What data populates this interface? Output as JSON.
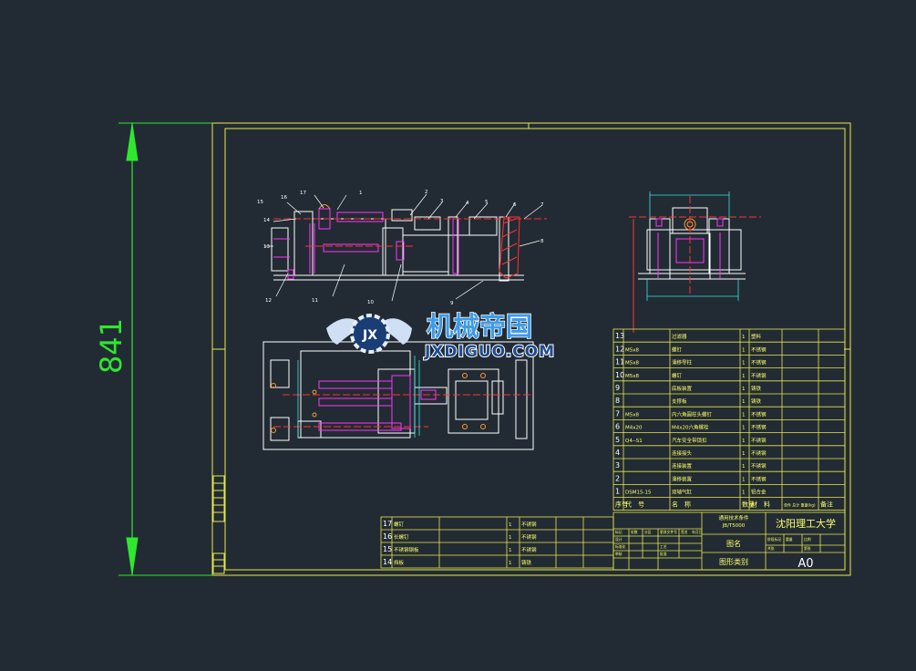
{
  "colors": {
    "background": "#222b33",
    "frame": "#e8e84a",
    "dimension": "#2ee82e",
    "outline": "#ffffff",
    "part": "#ff33ff",
    "center": "#ff3333",
    "hidden": "#33e6e6",
    "hatch": "#ff3333",
    "table_text": "#ffff66",
    "watermark": "#d6e8ff"
  },
  "dimension_label": "841",
  "watermark": {
    "title": "机械帝国",
    "subtitle": "JXDIGUO.COM",
    "badge": "JX"
  },
  "balloons": [
    "1",
    "2",
    "3",
    "4",
    "5",
    "6",
    "7",
    "8",
    "9",
    "10",
    "11",
    "12",
    "13",
    "14",
    "15",
    "16",
    "17"
  ],
  "bom_main": [
    {
      "no": "13",
      "code": "",
      "name": "过滤器",
      "qty": "1",
      "mat": "塑料"
    },
    {
      "no": "12",
      "code": "M5x8",
      "name": "螺钉",
      "qty": "1",
      "mat": "不锈钢"
    },
    {
      "no": "11",
      "code": "M5x8",
      "name": "滑移导柱",
      "qty": "1",
      "mat": "不锈钢"
    },
    {
      "no": "10",
      "code": "M5x8",
      "name": "螺钉",
      "qty": "1",
      "mat": "不锈钢"
    },
    {
      "no": "9",
      "code": "",
      "name": "底板装置",
      "qty": "1",
      "mat": "铸铁"
    },
    {
      "no": "8",
      "code": "",
      "name": "支撑板",
      "qty": "1",
      "mat": "铸铁"
    },
    {
      "no": "7",
      "code": "M5x8",
      "name": "内六角圆柱头螺钉",
      "qty": "1",
      "mat": "不锈钢"
    },
    {
      "no": "6",
      "code": "M4x20",
      "name": "M4x20六角螺栓",
      "qty": "1",
      "mat": "不锈钢"
    },
    {
      "no": "5",
      "code": "Q4--S1",
      "name": "汽车安全带锁扣",
      "qty": "1",
      "mat": "不锈钢"
    },
    {
      "no": "4",
      "code": "",
      "name": "连接接头",
      "qty": "1",
      "mat": "不锈钢"
    },
    {
      "no": "3",
      "code": "",
      "name": "连接装置",
      "qty": "1",
      "mat": "不锈钢"
    },
    {
      "no": "2",
      "code": "",
      "name": "滑移装置",
      "qty": "1",
      "mat": "不锈钢"
    },
    {
      "no": "1",
      "code": "DSM15-15",
      "name": "双轴气缸",
      "qty": "1",
      "mat": "铝合金"
    }
  ],
  "bom_header": [
    "序号",
    "代　号",
    "名　称",
    "数量",
    "材　料",
    "单件 总计 重量(kg)",
    "备注"
  ],
  "bom_left": [
    {
      "no": "17",
      "name": "螺钉",
      "qty": "1",
      "mat": "不锈钢"
    },
    {
      "no": "16",
      "name": "长螺钉",
      "qty": "1",
      "mat": "不锈钢"
    },
    {
      "no": "15",
      "name": "不锈钢钢板",
      "qty": "1",
      "mat": "不锈钢"
    },
    {
      "no": "14",
      "name": "挡板",
      "qty": "1",
      "mat": "铸铁"
    }
  ],
  "title_block": {
    "school": "沈阳理工大学",
    "standard": "通用技术条件",
    "standard_code": "JB/T5000",
    "drawing_name": "图名",
    "drawing_type": "图形类别",
    "size": "A0",
    "small": [
      "标记",
      "处数",
      "分区",
      "更改文件号",
      "签名",
      "年月日",
      "设计",
      "标准化",
      "审核",
      "工艺",
      "批准",
      "阶段标记",
      "重量",
      "比例",
      "共张",
      "第张"
    ]
  }
}
